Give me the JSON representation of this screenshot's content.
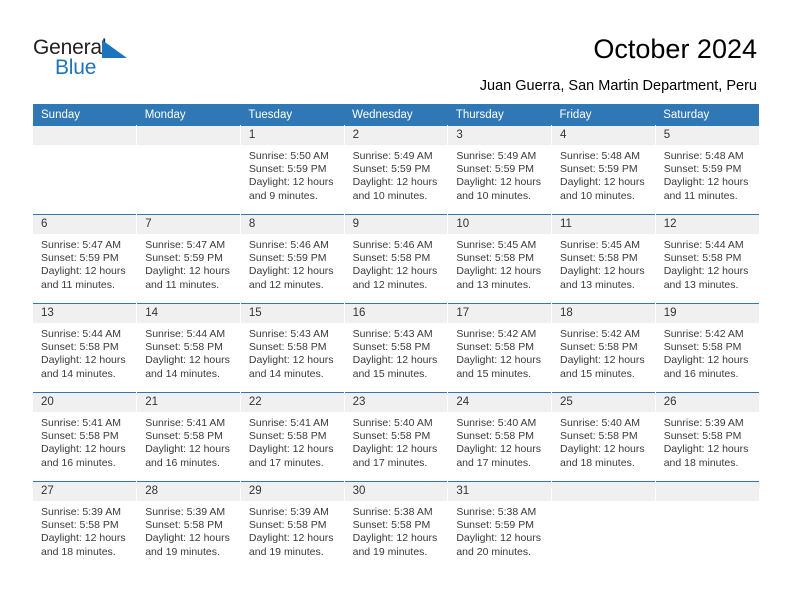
{
  "brand": {
    "name_top": "General",
    "name_bottom": "Blue",
    "accent_color": "#1b75bc"
  },
  "header": {
    "title": "October 2024",
    "subtitle": "Juan Guerra, San Martin Department, Peru"
  },
  "calendar": {
    "header_bg": "#3077b5",
    "daynum_bg": "#f0f0f0",
    "weekday_headers": [
      "Sunday",
      "Monday",
      "Tuesday",
      "Wednesday",
      "Thursday",
      "Friday",
      "Saturday"
    ],
    "weeks": [
      [
        {
          "day": "",
          "empty": true,
          "sunrise": "",
          "sunset": "",
          "daylight_1": "",
          "daylight_2": ""
        },
        {
          "day": "",
          "empty": true,
          "sunrise": "",
          "sunset": "",
          "daylight_1": "",
          "daylight_2": ""
        },
        {
          "day": "1",
          "empty": false,
          "sunrise": "Sunrise: 5:50 AM",
          "sunset": "Sunset: 5:59 PM",
          "daylight_1": "Daylight: 12 hours",
          "daylight_2": "and 9 minutes."
        },
        {
          "day": "2",
          "empty": false,
          "sunrise": "Sunrise: 5:49 AM",
          "sunset": "Sunset: 5:59 PM",
          "daylight_1": "Daylight: 12 hours",
          "daylight_2": "and 10 minutes."
        },
        {
          "day": "3",
          "empty": false,
          "sunrise": "Sunrise: 5:49 AM",
          "sunset": "Sunset: 5:59 PM",
          "daylight_1": "Daylight: 12 hours",
          "daylight_2": "and 10 minutes."
        },
        {
          "day": "4",
          "empty": false,
          "sunrise": "Sunrise: 5:48 AM",
          "sunset": "Sunset: 5:59 PM",
          "daylight_1": "Daylight: 12 hours",
          "daylight_2": "and 10 minutes."
        },
        {
          "day": "5",
          "empty": false,
          "sunrise": "Sunrise: 5:48 AM",
          "sunset": "Sunset: 5:59 PM",
          "daylight_1": "Daylight: 12 hours",
          "daylight_2": "and 11 minutes."
        }
      ],
      [
        {
          "day": "6",
          "empty": false,
          "sunrise": "Sunrise: 5:47 AM",
          "sunset": "Sunset: 5:59 PM",
          "daylight_1": "Daylight: 12 hours",
          "daylight_2": "and 11 minutes."
        },
        {
          "day": "7",
          "empty": false,
          "sunrise": "Sunrise: 5:47 AM",
          "sunset": "Sunset: 5:59 PM",
          "daylight_1": "Daylight: 12 hours",
          "daylight_2": "and 11 minutes."
        },
        {
          "day": "8",
          "empty": false,
          "sunrise": "Sunrise: 5:46 AM",
          "sunset": "Sunset: 5:59 PM",
          "daylight_1": "Daylight: 12 hours",
          "daylight_2": "and 12 minutes."
        },
        {
          "day": "9",
          "empty": false,
          "sunrise": "Sunrise: 5:46 AM",
          "sunset": "Sunset: 5:58 PM",
          "daylight_1": "Daylight: 12 hours",
          "daylight_2": "and 12 minutes."
        },
        {
          "day": "10",
          "empty": false,
          "sunrise": "Sunrise: 5:45 AM",
          "sunset": "Sunset: 5:58 PM",
          "daylight_1": "Daylight: 12 hours",
          "daylight_2": "and 13 minutes."
        },
        {
          "day": "11",
          "empty": false,
          "sunrise": "Sunrise: 5:45 AM",
          "sunset": "Sunset: 5:58 PM",
          "daylight_1": "Daylight: 12 hours",
          "daylight_2": "and 13 minutes."
        },
        {
          "day": "12",
          "empty": false,
          "sunrise": "Sunrise: 5:44 AM",
          "sunset": "Sunset: 5:58 PM",
          "daylight_1": "Daylight: 12 hours",
          "daylight_2": "and 13 minutes."
        }
      ],
      [
        {
          "day": "13",
          "empty": false,
          "sunrise": "Sunrise: 5:44 AM",
          "sunset": "Sunset: 5:58 PM",
          "daylight_1": "Daylight: 12 hours",
          "daylight_2": "and 14 minutes."
        },
        {
          "day": "14",
          "empty": false,
          "sunrise": "Sunrise: 5:44 AM",
          "sunset": "Sunset: 5:58 PM",
          "daylight_1": "Daylight: 12 hours",
          "daylight_2": "and 14 minutes."
        },
        {
          "day": "15",
          "empty": false,
          "sunrise": "Sunrise: 5:43 AM",
          "sunset": "Sunset: 5:58 PM",
          "daylight_1": "Daylight: 12 hours",
          "daylight_2": "and 14 minutes."
        },
        {
          "day": "16",
          "empty": false,
          "sunrise": "Sunrise: 5:43 AM",
          "sunset": "Sunset: 5:58 PM",
          "daylight_1": "Daylight: 12 hours",
          "daylight_2": "and 15 minutes."
        },
        {
          "day": "17",
          "empty": false,
          "sunrise": "Sunrise: 5:42 AM",
          "sunset": "Sunset: 5:58 PM",
          "daylight_1": "Daylight: 12 hours",
          "daylight_2": "and 15 minutes."
        },
        {
          "day": "18",
          "empty": false,
          "sunrise": "Sunrise: 5:42 AM",
          "sunset": "Sunset: 5:58 PM",
          "daylight_1": "Daylight: 12 hours",
          "daylight_2": "and 15 minutes."
        },
        {
          "day": "19",
          "empty": false,
          "sunrise": "Sunrise: 5:42 AM",
          "sunset": "Sunset: 5:58 PM",
          "daylight_1": "Daylight: 12 hours",
          "daylight_2": "and 16 minutes."
        }
      ],
      [
        {
          "day": "20",
          "empty": false,
          "sunrise": "Sunrise: 5:41 AM",
          "sunset": "Sunset: 5:58 PM",
          "daylight_1": "Daylight: 12 hours",
          "daylight_2": "and 16 minutes."
        },
        {
          "day": "21",
          "empty": false,
          "sunrise": "Sunrise: 5:41 AM",
          "sunset": "Sunset: 5:58 PM",
          "daylight_1": "Daylight: 12 hours",
          "daylight_2": "and 16 minutes."
        },
        {
          "day": "22",
          "empty": false,
          "sunrise": "Sunrise: 5:41 AM",
          "sunset": "Sunset: 5:58 PM",
          "daylight_1": "Daylight: 12 hours",
          "daylight_2": "and 17 minutes."
        },
        {
          "day": "23",
          "empty": false,
          "sunrise": "Sunrise: 5:40 AM",
          "sunset": "Sunset: 5:58 PM",
          "daylight_1": "Daylight: 12 hours",
          "daylight_2": "and 17 minutes."
        },
        {
          "day": "24",
          "empty": false,
          "sunrise": "Sunrise: 5:40 AM",
          "sunset": "Sunset: 5:58 PM",
          "daylight_1": "Daylight: 12 hours",
          "daylight_2": "and 17 minutes."
        },
        {
          "day": "25",
          "empty": false,
          "sunrise": "Sunrise: 5:40 AM",
          "sunset": "Sunset: 5:58 PM",
          "daylight_1": "Daylight: 12 hours",
          "daylight_2": "and 18 minutes."
        },
        {
          "day": "26",
          "empty": false,
          "sunrise": "Sunrise: 5:39 AM",
          "sunset": "Sunset: 5:58 PM",
          "daylight_1": "Daylight: 12 hours",
          "daylight_2": "and 18 minutes."
        }
      ],
      [
        {
          "day": "27",
          "empty": false,
          "sunrise": "Sunrise: 5:39 AM",
          "sunset": "Sunset: 5:58 PM",
          "daylight_1": "Daylight: 12 hours",
          "daylight_2": "and 18 minutes."
        },
        {
          "day": "28",
          "empty": false,
          "sunrise": "Sunrise: 5:39 AM",
          "sunset": "Sunset: 5:58 PM",
          "daylight_1": "Daylight: 12 hours",
          "daylight_2": "and 19 minutes."
        },
        {
          "day": "29",
          "empty": false,
          "sunrise": "Sunrise: 5:39 AM",
          "sunset": "Sunset: 5:58 PM",
          "daylight_1": "Daylight: 12 hours",
          "daylight_2": "and 19 minutes."
        },
        {
          "day": "30",
          "empty": false,
          "sunrise": "Sunrise: 5:38 AM",
          "sunset": "Sunset: 5:58 PM",
          "daylight_1": "Daylight: 12 hours",
          "daylight_2": "and 19 minutes."
        },
        {
          "day": "31",
          "empty": false,
          "sunrise": "Sunrise: 5:38 AM",
          "sunset": "Sunset: 5:59 PM",
          "daylight_1": "Daylight: 12 hours",
          "daylight_2": "and 20 minutes."
        },
        {
          "day": "",
          "empty": true,
          "sunrise": "",
          "sunset": "",
          "daylight_1": "",
          "daylight_2": ""
        },
        {
          "day": "",
          "empty": true,
          "sunrise": "",
          "sunset": "",
          "daylight_1": "",
          "daylight_2": ""
        }
      ]
    ]
  }
}
